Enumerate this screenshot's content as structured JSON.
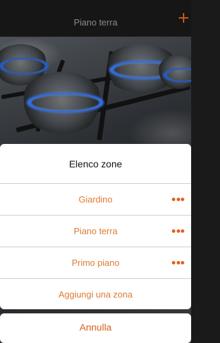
{
  "header": {
    "title": "Piano terra",
    "add_icon": "plus-icon",
    "accent": "#c5581b"
  },
  "sheet": {
    "title": "Elenco zone",
    "items": [
      {
        "label": "Giardino",
        "more_icon": "more-horizontal-icon"
      },
      {
        "label": "Piano terra",
        "more_icon": "more-horizontal-icon"
      },
      {
        "label": "Primo piano",
        "more_icon": "more-horizontal-icon"
      }
    ],
    "add_label": "Aggiungi una zona",
    "item_color": "#e07a33"
  },
  "cancel": {
    "label": "Annulla",
    "color": "#d8601a"
  }
}
